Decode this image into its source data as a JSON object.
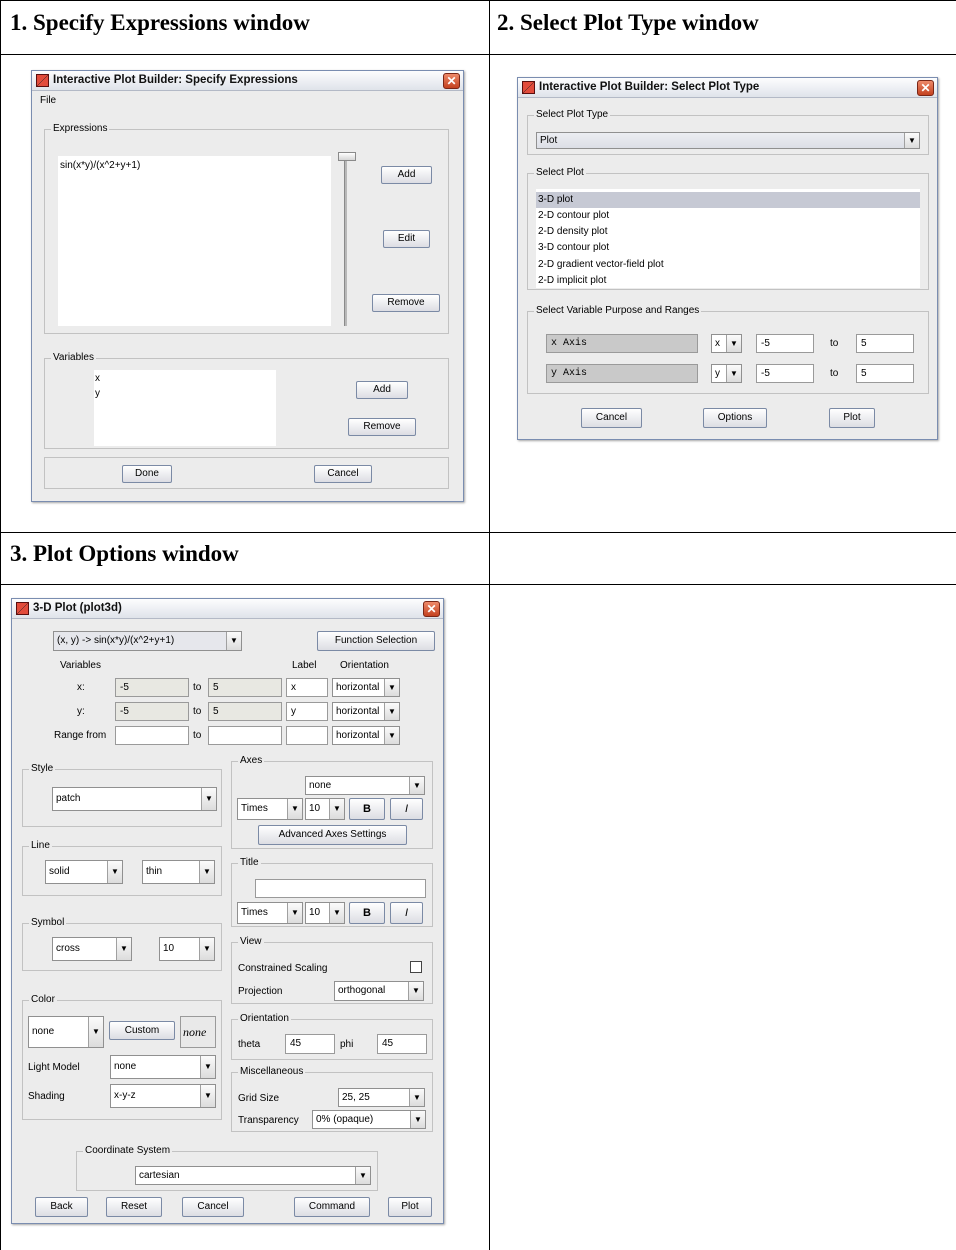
{
  "panels": {
    "p1_title": "1. Specify Expressions window",
    "p2_title": "2. Select Plot Type window",
    "p3_title": "3. Plot Options window",
    "p4_title": ""
  },
  "specify": {
    "title": "Interactive Plot Builder: Specify Expressions",
    "menu_file": "File",
    "expressions_label": "Expressions",
    "expressions": [
      "sin(x*y)/(x^2+y+1)"
    ],
    "add": "Add",
    "edit": "Edit",
    "remove": "Remove",
    "variables_label": "Variables",
    "variables": [
      "x",
      "y"
    ],
    "var_add": "Add",
    "var_remove": "Remove",
    "done": "Done",
    "cancel": "Cancel"
  },
  "select": {
    "title": "Interactive Plot Builder: Select Plot Type",
    "type_label": "Select Plot Type",
    "type_value": "Plot",
    "plot_label": "Select Plot",
    "plots": [
      "3-D plot",
      "2-D contour plot",
      "2-D density plot",
      "3-D contour plot",
      "2-D gradient vector-field plot",
      "2-D implicit plot"
    ],
    "selected_index": 0,
    "ranges_label": "Select Variable Purpose and Ranges",
    "rows": [
      {
        "axis": "x Axis",
        "var": "x",
        "from": "-5",
        "to_label": "to",
        "to": "5"
      },
      {
        "axis": "y Axis",
        "var": "y",
        "from": "-5",
        "to_label": "to",
        "to": "5"
      }
    ],
    "cancel": "Cancel",
    "options": "Options",
    "plot": "Plot"
  },
  "options": {
    "title": "3-D Plot (plot3d)",
    "function": "(x, y) -> sin(x*y)/(x^2+y+1)",
    "function_selection": "Function Selection",
    "variables_head": "Variables",
    "label_head": "Label",
    "orientation_head": "Orientation",
    "var_rows": [
      {
        "name": "x:",
        "from": "-5",
        "to_label": "to",
        "to": "5",
        "label": "x",
        "orient": "horizontal"
      },
      {
        "name": "y:",
        "from": "-5",
        "to_label": "to",
        "to": "5",
        "label": "y",
        "orient": "horizontal"
      },
      {
        "name": "Range from",
        "from": "",
        "to_label": "to",
        "to": "",
        "label": "",
        "orient": "horizontal"
      }
    ],
    "style_label": "Style",
    "style_value": "patch",
    "line_label": "Line",
    "line_style": "solid",
    "line_width": "thin",
    "symbol_label": "Symbol",
    "symbol_value": "cross",
    "symbol_size": "10",
    "color_label": "Color",
    "color_value": "none",
    "custom": "Custom",
    "color_swatch": "none",
    "light_model_label": "Light Model",
    "light_model_value": "none",
    "shading_label": "Shading",
    "shading_value": "x-y-z",
    "axes_label": "Axes",
    "axes_value": "none",
    "axes_font": "Times",
    "axes_size": "10",
    "bold": "B",
    "italic": "I",
    "advanced_axes": "Advanced Axes Settings",
    "title_label": "Title",
    "title_value": "",
    "title_font": "Times",
    "title_size": "10",
    "view_label": "View",
    "constrained": "Constrained Scaling",
    "projection_label": "Projection",
    "projection_value": "orthogonal",
    "orientation_label": "Orientation",
    "theta_label": "theta",
    "theta_value": "45",
    "phi_label": "phi",
    "phi_value": "45",
    "misc_label": "Miscellaneous",
    "grid_label": "Grid Size",
    "grid_value": "25, 25",
    "transparency_label": "Transparency",
    "transparency_value": "0% (opaque)",
    "coord_label": "Coordinate System",
    "coord_value": "cartesian",
    "back": "Back",
    "reset": "Reset",
    "cancel": "Cancel",
    "command": "Command",
    "plot": "Plot"
  }
}
